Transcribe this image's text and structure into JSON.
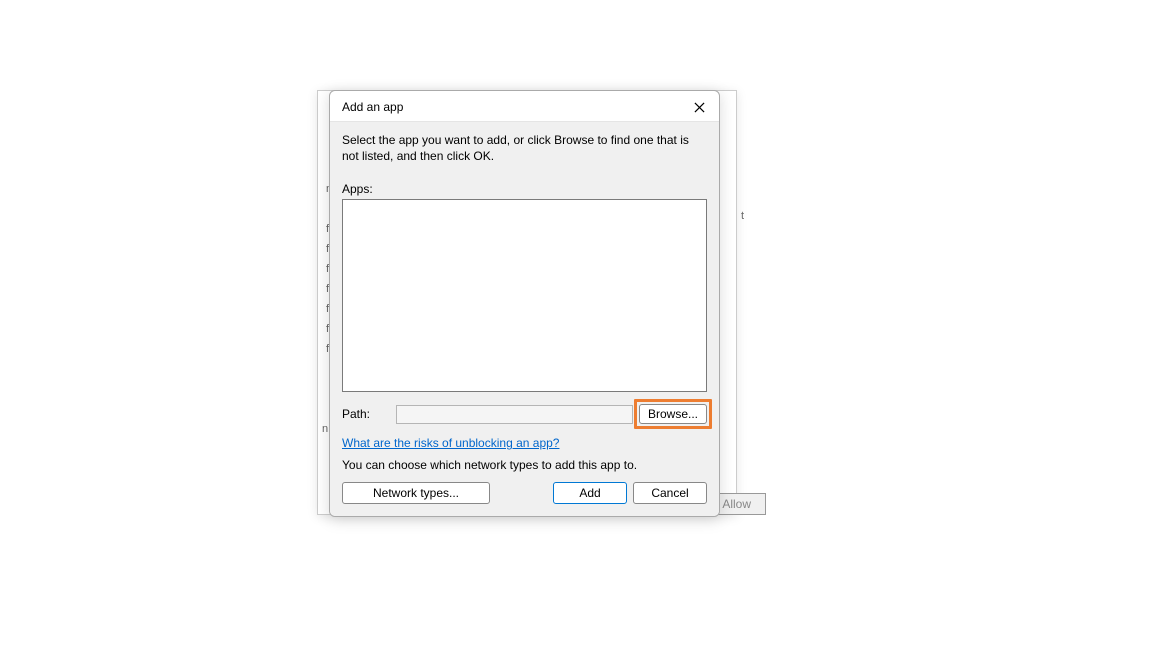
{
  "dialog": {
    "title": "Add an app",
    "instruction": "Select the app you want to add, or click Browse to find one that is not listed, and then click OK.",
    "apps_label": "Apps:",
    "path_label": "Path:",
    "path_value": "",
    "browse_label": "Browse...",
    "risks_link": "What are the risks of unblocking an app?",
    "network_text": "You can choose which network types to add this app to.",
    "network_types_label": "Network types...",
    "add_label": "Add",
    "cancel_label": "Cancel"
  },
  "background": {
    "button_label": "Allow"
  },
  "bg_fragments": {
    "n1": "n",
    "n2": "n",
    "ft": "ft",
    "t": "t"
  }
}
